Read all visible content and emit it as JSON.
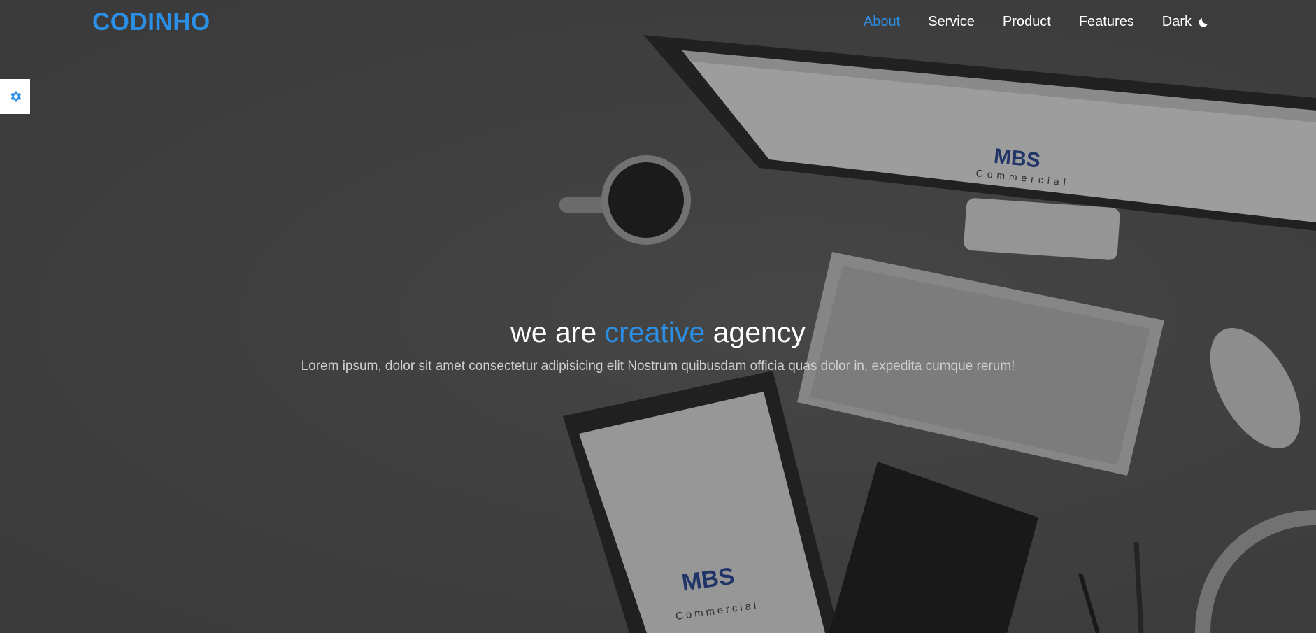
{
  "brand": {
    "name": "CODINHO"
  },
  "nav": {
    "items": [
      {
        "label": "About",
        "active": true
      },
      {
        "label": "Service",
        "active": false
      },
      {
        "label": "Product",
        "active": false
      },
      {
        "label": "Features",
        "active": false
      }
    ],
    "theme_toggle": {
      "label": "Dark",
      "icon": "moon-icon"
    }
  },
  "settings": {
    "icon": "gear-icon"
  },
  "hero": {
    "headline_prefix": "we are",
    "headline_accent": "creative",
    "headline_suffix": "agency",
    "subtitle": "Lorem ipsum, dolor sit amet consectetur adipisicing elit Nostrum quibusdam officia quas dolor in, expedita cumque rerum!",
    "background_image": {
      "monitor_logo": "MBS",
      "monitor_caption": "Commercial",
      "tablet_logo": "MBS",
      "tablet_caption": "Commercial"
    }
  },
  "colors": {
    "accent": "#2b8fe6",
    "text": "#ffffff",
    "muted_text": "#cfcfcf"
  }
}
